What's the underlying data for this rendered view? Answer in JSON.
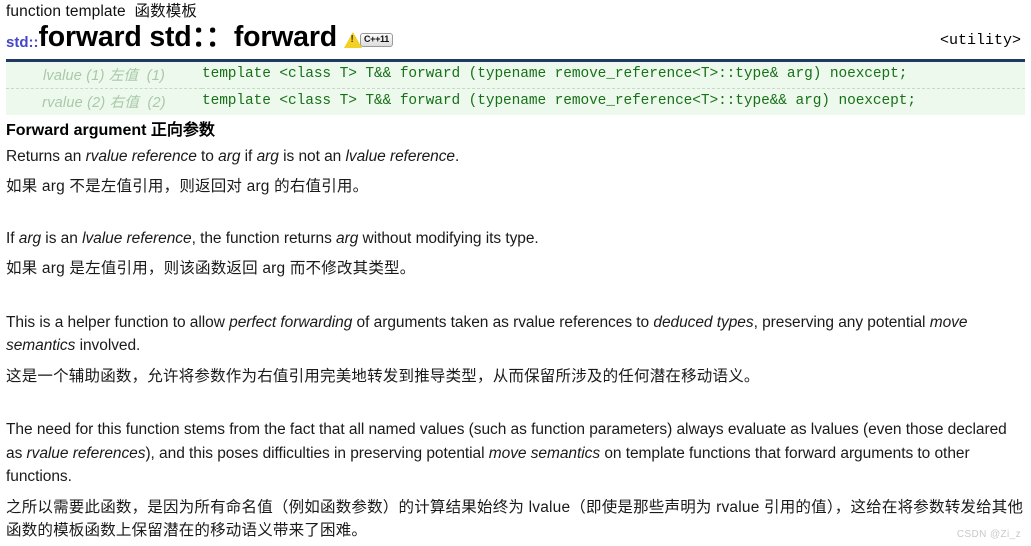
{
  "header": {
    "kicker": "function template  函数模板",
    "std_prefix": "std::",
    "title": "forward std：：forward",
    "badge_warning_icon": "warning-triangle-icon",
    "badge_cpp": "C++11",
    "include_header": "<utility>"
  },
  "signatures": [
    {
      "label": "lvalue (1) 左值  (1)",
      "code": "template <class T> T&& forward (typename remove_reference<T>::type& arg) noexcept;"
    },
    {
      "label": "rvalue (2) 右值  (2)",
      "code": "template <class T> T&& forward (typename remove_reference<T>::type&& arg) noexcept;"
    }
  ],
  "section": {
    "heading": "Forward argument 正向参数",
    "paragraphs": [
      {
        "lang": "en",
        "parts": [
          {
            "text": "Returns an ",
            "em": false
          },
          {
            "text": "rvalue reference",
            "em": true
          },
          {
            "text": " to ",
            "em": false
          },
          {
            "text": "arg",
            "em": true
          },
          {
            "text": " if ",
            "em": false
          },
          {
            "text": "arg",
            "em": true
          },
          {
            "text": " is not an ",
            "em": false
          },
          {
            "text": "lvalue reference",
            "em": true
          },
          {
            "text": ".",
            "em": false
          }
        ]
      },
      {
        "lang": "zh",
        "parts": [
          {
            "text": "如果 arg 不是左值引用，则返回对 arg 的右值引用。",
            "em": false
          }
        ]
      },
      {
        "lang": "en",
        "parts": [
          {
            "text": "If ",
            "em": false
          },
          {
            "text": "arg",
            "em": true
          },
          {
            "text": " is an ",
            "em": false
          },
          {
            "text": "lvalue reference",
            "em": true
          },
          {
            "text": ", the function returns ",
            "em": false
          },
          {
            "text": "arg",
            "em": true
          },
          {
            "text": " without modifying its type.",
            "em": false
          }
        ]
      },
      {
        "lang": "zh",
        "parts": [
          {
            "text": "如果 arg 是左值引用，则该函数返回 arg 而不修改其类型。",
            "em": false
          }
        ]
      },
      {
        "lang": "en",
        "parts": [
          {
            "text": "This is a helper function to allow ",
            "em": false
          },
          {
            "text": "perfect forwarding",
            "em": true
          },
          {
            "text": " of arguments taken as rvalue references to ",
            "em": false
          },
          {
            "text": "deduced types",
            "em": true
          },
          {
            "text": ", preserving any potential ",
            "em": false
          },
          {
            "text": "move semantics",
            "em": true
          },
          {
            "text": " involved.",
            "em": false
          }
        ]
      },
      {
        "lang": "zh",
        "parts": [
          {
            "text": "这是一个辅助函数，允许将参数作为右值引用完美地转发到推导类型，从而保留所涉及的任何潜在移动语义。",
            "em": false
          }
        ]
      },
      {
        "lang": "en",
        "parts": [
          {
            "text": "The need for this function stems from the fact that all named values (such as function parameters) always evaluate as lvalues (even those declared as ",
            "em": false
          },
          {
            "text": "rvalue references",
            "em": true
          },
          {
            "text": "), and this poses difficulties in preserving potential ",
            "em": false
          },
          {
            "text": "move semantics",
            "em": true
          },
          {
            "text": " on template functions that forward arguments to other functions.",
            "em": false
          }
        ]
      },
      {
        "lang": "zh",
        "parts": [
          {
            "text": "之所以需要此函数，是因为所有命名值（例如函数参数）的计算结果始终为 lvalue（即使是那些声明为 rvalue 引用的值），这给在将参数转发给其他函数的模板函数上保留潜在的移动语义带来了困难。",
            "em": false
          }
        ]
      }
    ]
  },
  "watermark": "CSDN @Zi_z",
  "colors": {
    "rule": "#1f3864",
    "code_green": "#177117",
    "label_green": "#a8c9a8",
    "sig_bg": "#eef9ee",
    "std_blue": "#4646c8",
    "badge_yellow": "#f2d024"
  }
}
